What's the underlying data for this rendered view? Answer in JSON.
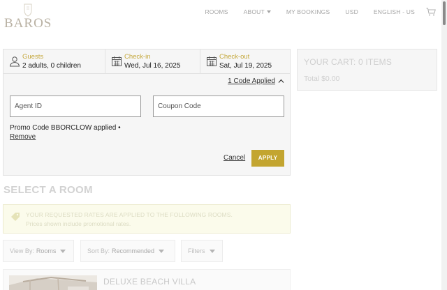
{
  "header": {
    "logo_text": "BAROS",
    "nav": [
      {
        "label": "ROOMS"
      },
      {
        "label": "ABOUT"
      },
      {
        "label": "MY BOOKINGS"
      },
      {
        "label": "USD"
      },
      {
        "label": "ENGLISH - US"
      }
    ],
    "cart_icon": "shopping-cart-icon"
  },
  "search": {
    "guests": {
      "label": "Guests",
      "value": "2 adults, 0 children",
      "icon": "person-icon"
    },
    "checkin": {
      "label": "Check-in",
      "value": "Wed, Jul 16, 2025",
      "icon": "calendar-icon"
    },
    "checkout": {
      "label": "Check-out",
      "value": "Sat, Jul 19, 2025",
      "icon": "calendar-icon"
    },
    "code_toggle": "1 Code Applied",
    "agent_placeholder": "Agent ID",
    "coupon_placeholder": "Coupon Code",
    "promo_text": "Promo Code BBORCLOW applied •",
    "remove_label": "Remove",
    "cancel_label": "Cancel",
    "apply_label": "APPLY"
  },
  "cart": {
    "title": "YOUR CART: 0 ITEMS",
    "total": "Total $0.00"
  },
  "rooms": {
    "title": "SELECT A ROOM",
    "notice_line1": "YOUR REQUESTED RATES ARE APPLIED TO THE FOLLOWING ROOMS.",
    "notice_line2": "Prices shown include promotional rates.",
    "view_by_label": "View By:",
    "view_by_value": "Rooms",
    "sort_by_label": "Sort By:",
    "sort_by_value": "Recommended",
    "filters_label": "Filters",
    "first_room_name": "DELUXE BEACH VILLA"
  },
  "colors": {
    "accent_gold": "#c3a530",
    "label_gold": "#c4a73a",
    "panel_bg": "#f6f6f6"
  }
}
